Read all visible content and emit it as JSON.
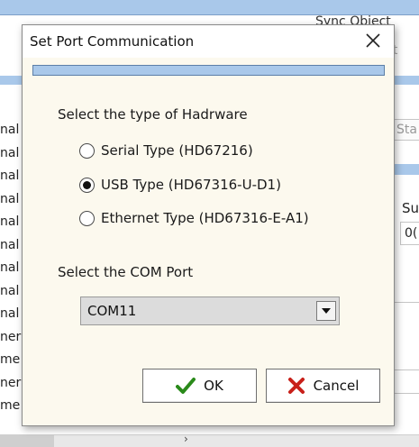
{
  "background": {
    "sync_title": "Sync Object",
    "sync_sub": "it",
    "left_column": [
      "nal",
      "nal",
      "nal",
      "nal",
      "nal",
      "nal",
      "nal",
      "nal",
      "nal",
      "ner",
      "me",
      "ner",
      "me"
    ],
    "right_box": "Sta",
    "right_sub": "Su",
    "right_field": "0("
  },
  "dialog": {
    "title": "Set Port Communication",
    "hardware_label": "Select the type of Hadrware",
    "hardware_options": [
      {
        "label": "Serial Type (HD67216)",
        "selected": false
      },
      {
        "label": "USB Type (HD67316-U-D1)",
        "selected": true
      },
      {
        "label": "Ethernet Type (HD67316-E-A1)",
        "selected": false
      }
    ],
    "com_label": "Select the COM Port",
    "com_port_selected": "COM11",
    "ok_label": "OK",
    "cancel_label": "Cancel"
  },
  "colors": {
    "dialog_bg": "#fcf9ee",
    "header_band": "#a9c8ea",
    "ok_check": "#2a8a1a",
    "cancel_x": "#c8201a"
  }
}
